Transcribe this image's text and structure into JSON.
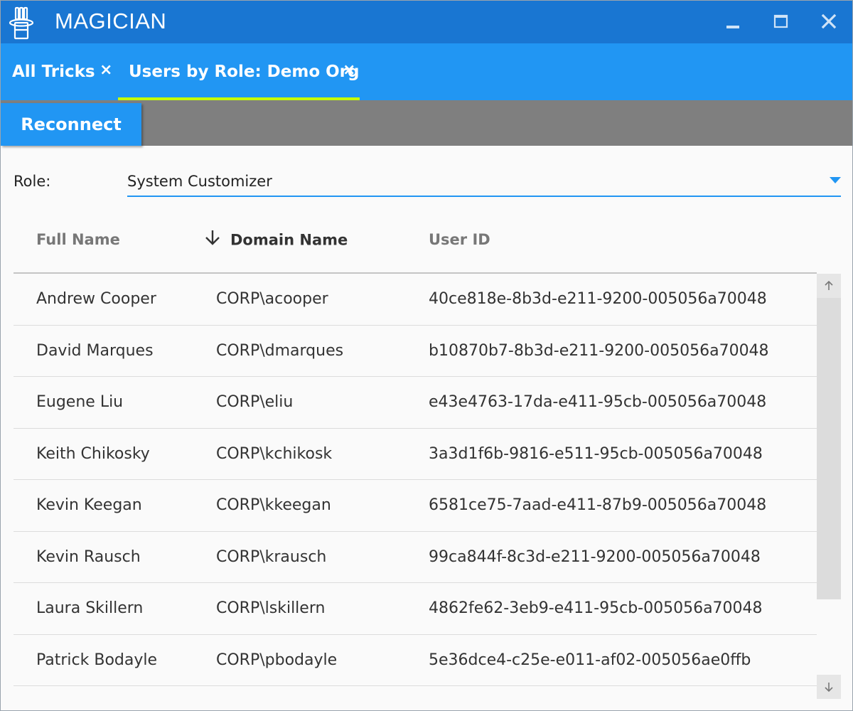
{
  "app": {
    "title": "MAGICIAN",
    "logo_icon": "magic-hat-icon",
    "accent_color": "#1976d2"
  },
  "window_controls": {
    "minimize_icon": "minimize-icon",
    "maximize_icon": "maximize-icon",
    "close_icon": "close-icon"
  },
  "tabs": [
    {
      "label": "All Tricks",
      "close": "×",
      "active": false
    },
    {
      "label": "Users by Role: Demo Org",
      "close": "×",
      "active": true
    }
  ],
  "toolbar": {
    "reconnect_label": "Reconnect"
  },
  "role_filter": {
    "label": "Role:",
    "selected": "System Customizer"
  },
  "grid": {
    "columns": [
      {
        "label": "Full Name"
      },
      {
        "label": "Domain Name",
        "sorted": "descending",
        "sort_icon": "arrow-down-icon"
      },
      {
        "label": "User ID"
      }
    ],
    "rows": [
      {
        "full_name": "Andrew Cooper",
        "domain_name": "CORP\\acooper",
        "user_id": "40ce818e-8b3d-e211-9200-005056a70048"
      },
      {
        "full_name": "David Marques",
        "domain_name": "CORP\\dmarques",
        "user_id": "b10870b7-8b3d-e211-9200-005056a70048"
      },
      {
        "full_name": "Eugene Liu",
        "domain_name": "CORP\\eliu",
        "user_id": "e43e4763-17da-e411-95cb-005056a70048"
      },
      {
        "full_name": "Keith Chikosky",
        "domain_name": "CORP\\kchikosk",
        "user_id": "3a3d1f6b-9816-e511-95cb-005056a70048"
      },
      {
        "full_name": "Kevin Keegan",
        "domain_name": "CORP\\kkeegan",
        "user_id": "6581ce75-7aad-e411-87b9-005056a70048"
      },
      {
        "full_name": "Kevin Rausch",
        "domain_name": "CORP\\krausch",
        "user_id": "99ca844f-8c3d-e211-9200-005056a70048"
      },
      {
        "full_name": "Laura Skillern",
        "domain_name": "CORP\\lskillern",
        "user_id": "4862fe62-3eb9-e411-95cb-005056a70048"
      },
      {
        "full_name": "Patrick Bodayle",
        "domain_name": "CORP\\pbodayle",
        "user_id": "5e36dce4-c25e-e011-af02-005056ae0ffb"
      }
    ]
  },
  "scrollbar": {
    "up_icon": "scroll-up-arrow-icon",
    "down_icon": "scroll-down-arrow-icon"
  }
}
